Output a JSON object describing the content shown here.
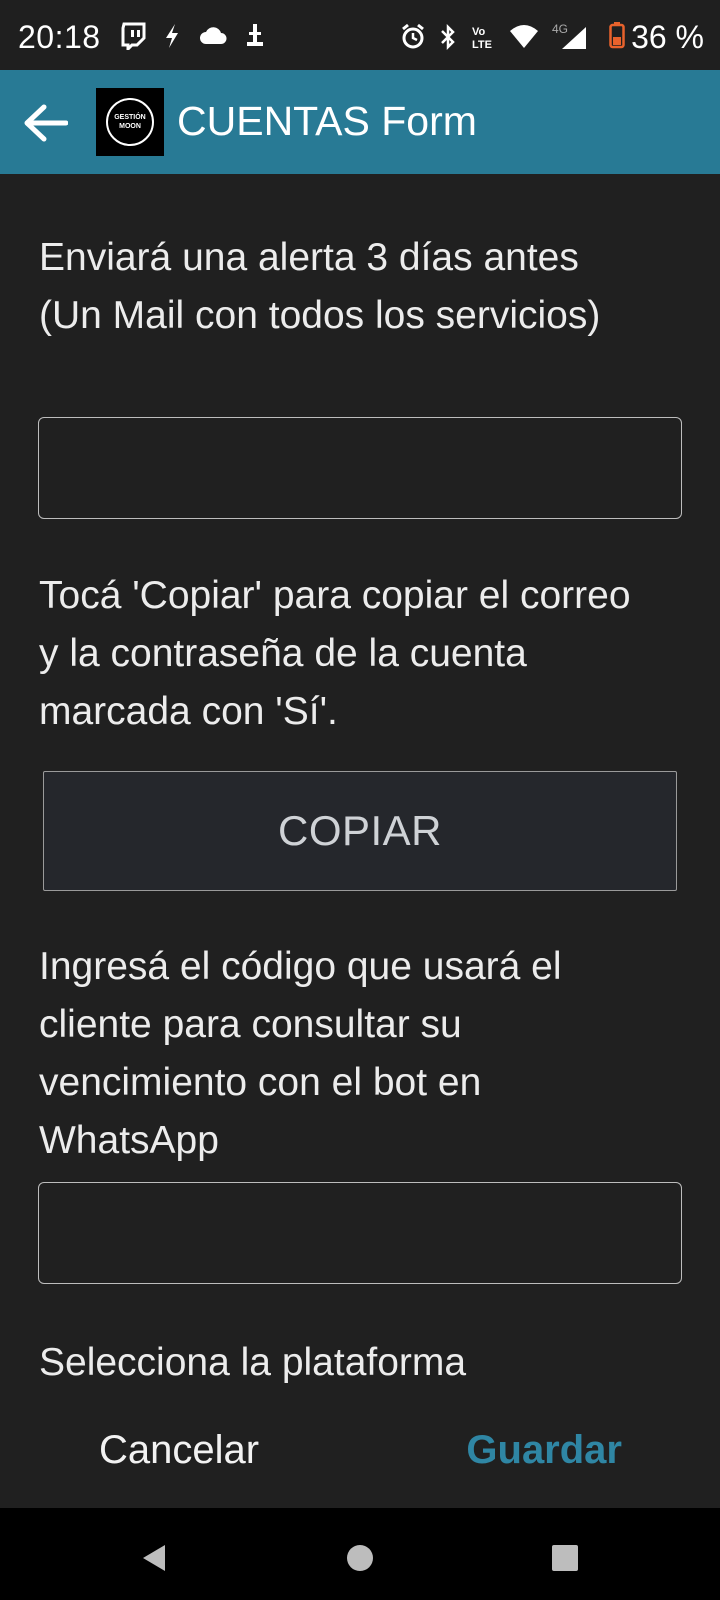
{
  "status_bar": {
    "time": "20:18",
    "battery": "36 %",
    "network": "4G",
    "volte": "Vo LTE",
    "left_icons": [
      "twitch-icon",
      "flash-icon",
      "cloud-icon",
      "usb-icon"
    ],
    "right_icons": [
      "alarm-icon",
      "bluetooth-icon",
      "volte-icon",
      "wifi-icon",
      "signal-icon",
      "battery-icon"
    ]
  },
  "app_bar": {
    "title": "CUENTAS Form",
    "logo_line1": "GESTIÓN",
    "logo_line2": "MOON",
    "background": "#287a95"
  },
  "form": {
    "alert_label": "Enviará una alerta 3 días antes (Un Mail con todos los servicios)",
    "alert_value": "",
    "copy_label": "Tocá 'Copiar' para copiar el correo y la contraseña de la cuenta marcada con 'Sí'.",
    "copy_button": "COPIAR",
    "code_label": "Ingresá el código que usará el cliente para consultar su vencimiento con el bot en WhatsApp",
    "code_value": "",
    "platform_label": "Selecciona la plataforma"
  },
  "actions": {
    "cancel": "Cancelar",
    "save": "Guardar",
    "save_color": "#2f86a4"
  },
  "nav_bar": {
    "icons": [
      "back-triangle-icon",
      "home-circle-icon",
      "recents-square-icon"
    ]
  }
}
